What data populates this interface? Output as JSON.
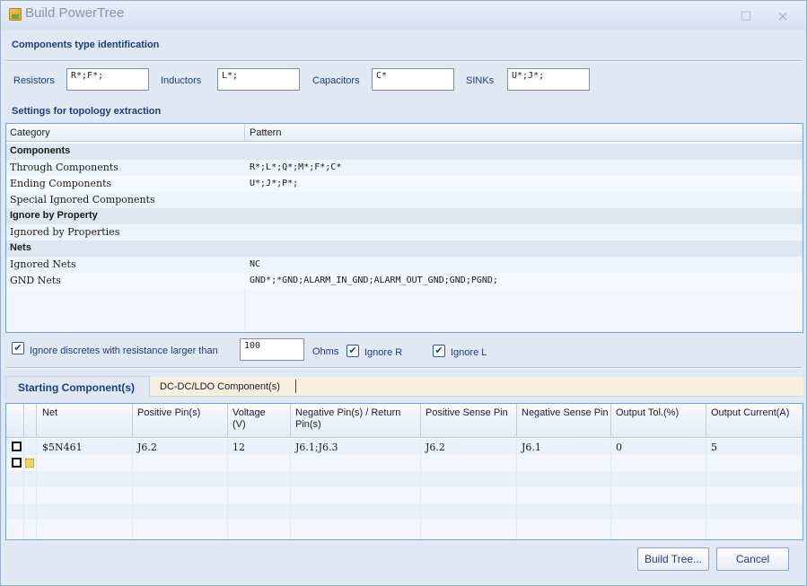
{
  "window": {
    "title": "Build PowerTree",
    "maximize_glyph": "□",
    "close_glyph": "×"
  },
  "components_type": {
    "heading": "Components type identification",
    "resistors_label": "Resistors",
    "resistors_value": "R*;F*;",
    "inductors_label": "Inductors",
    "inductors_value": "L*;",
    "capacitors_label": "Capacitors",
    "capacitors_value": "C*",
    "sinks_label": "SINKs",
    "sinks_value": "U*;J*;"
  },
  "topology": {
    "heading": "Settings for topology extraction",
    "col_category": "Category",
    "col_pattern": "Pattern",
    "rows": [
      {
        "category": "Components",
        "pattern": "",
        "group": true
      },
      {
        "category": "Through Components",
        "pattern": "R*;L*;Q*;M*;F*;C*",
        "group": false
      },
      {
        "category": "Ending Components",
        "pattern": "U*;J*;P*;",
        "group": false
      },
      {
        "category": "Special Ignored Components",
        "pattern": "",
        "group": false
      },
      {
        "category": "Ignore by Property",
        "pattern": "",
        "group": true
      },
      {
        "category": "Ignored by Properties",
        "pattern": "",
        "group": false
      },
      {
        "category": "Nets",
        "pattern": "",
        "group": true
      },
      {
        "category": "Ignored Nets",
        "pattern": "NC",
        "group": false
      },
      {
        "category": "GND Nets",
        "pattern": "GND*;*GND;ALARM_IN_GND;ALARM_OUT_GND;GND;PGND;",
        "group": false
      }
    ]
  },
  "options": {
    "ignore_discretes_label": "Ignore discretes with resistance larger than",
    "ignore_discretes_checked": true,
    "resistance_value": "100",
    "ohms_label": "Ohms",
    "ignore_r_label": "Ignore R",
    "ignore_r_checked": true,
    "ignore_l_label": "Ignore L",
    "ignore_l_checked": true,
    "check_glyph": "✔"
  },
  "tabs": {
    "starting": "Starting Component(s)",
    "dcdc": "DC-DC/LDO Component(s)"
  },
  "start_grid": {
    "columns": [
      "Net",
      "Positive Pin(s)",
      "Voltage (V)",
      "Negative Pin(s) / Return Pin(s)",
      "Positive Sense Pin",
      "Negative Sense Pin",
      "Output Tol.(%)",
      "Output Current(A)"
    ],
    "rows": [
      {
        "net": "$5N461",
        "positive_pins": "J6.2",
        "voltage": "12",
        "negative_pins": "J6.1;J6.3",
        "pos_sense": "J6.2",
        "neg_sense": "J6.1",
        "output_tol": "0",
        "output_current": "5"
      }
    ]
  },
  "buttons": {
    "build_tree": "Build Tree...",
    "cancel": "Cancel"
  }
}
